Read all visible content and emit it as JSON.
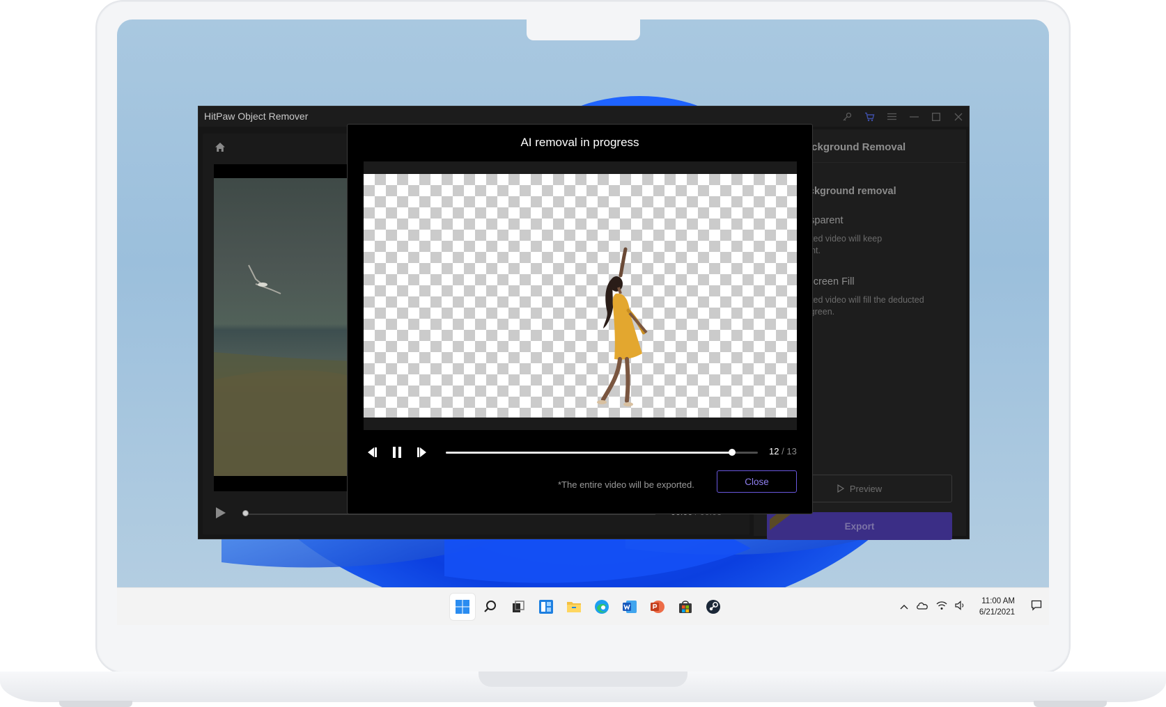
{
  "app": {
    "title": "HitPaw Object Remover",
    "window_controls": [
      "key-icon",
      "cart-icon",
      "menu-icon",
      "minimize-icon",
      "maximize-icon",
      "close-icon"
    ]
  },
  "editor": {
    "home_icon": "home-icon",
    "playback": {
      "current": "00:00",
      "separator": "/",
      "total": "00:03",
      "progress": 0.0
    }
  },
  "right_panel": {
    "title": "Background Removal",
    "section": "background removal",
    "options": [
      {
        "title": "ansparent",
        "desc_line1": "ported video will keep",
        "desc_line2": "arent."
      },
      {
        "title": "n Screen Fill",
        "desc_line1": "ported video will fill the deducted",
        "desc_line2": "ith green."
      }
    ],
    "preview_label": "Preview",
    "export_label": "Export"
  },
  "modal": {
    "title": "AI removal in progress",
    "progress_fraction": 0.917,
    "frame_current": "12",
    "frame_separator": "/",
    "frame_total": "13",
    "note": "*The entire video will be exported.",
    "close_label": "Close"
  },
  "taskbar": {
    "apps": [
      "windows-start-icon",
      "search-icon",
      "task-view-icon",
      "widgets-icon",
      "file-explorer-icon",
      "edge-icon",
      "word-icon",
      "powerpoint-icon",
      "store-icon",
      "steam-icon"
    ],
    "tray": [
      "chevron-up-icon",
      "onedrive-icon",
      "wifi-icon",
      "volume-icon"
    ],
    "time": "11:00 AM",
    "date": "6/21/2021"
  },
  "colors": {
    "accent": "#6a58e0",
    "export_button": "#3b2e86",
    "dress": "#e3a72f"
  }
}
